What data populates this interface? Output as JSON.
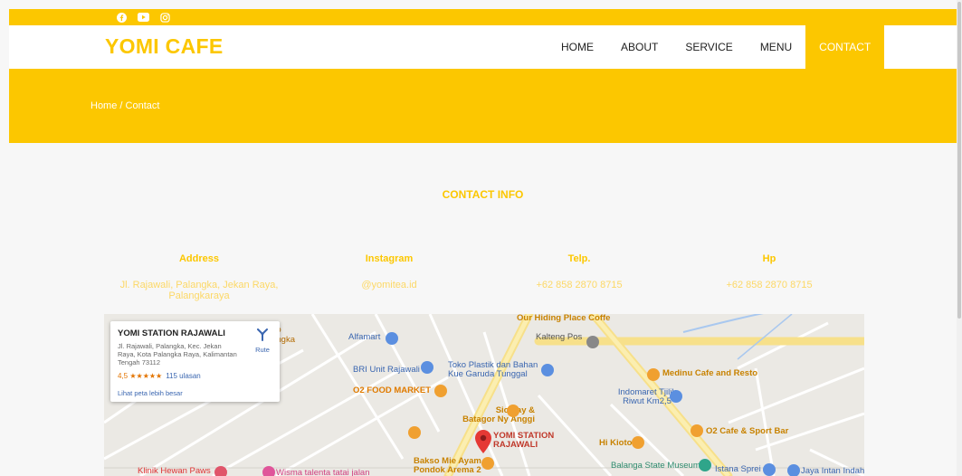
{
  "social": {
    "icons": [
      "facebook-icon",
      "youtube-icon",
      "instagram-icon"
    ]
  },
  "brand": {
    "name": "YOMI CAFE"
  },
  "nav": {
    "items": [
      {
        "label": "HOME",
        "active": false
      },
      {
        "label": "ABOUT",
        "active": false
      },
      {
        "label": "SERVICE",
        "active": false
      },
      {
        "label": "MENU",
        "active": false
      },
      {
        "label": "CONTACT",
        "active": true
      }
    ]
  },
  "breadcrumb": {
    "text": "Home / Contact"
  },
  "contact": {
    "title": "CONTACT INFO",
    "address": {
      "label": "Address",
      "value": "Jl. Rajawali, Palangka, Jekan Raya, Palangkaraya"
    },
    "instagram": {
      "label": "Instagram",
      "value": "@yomitea.id"
    },
    "telp": {
      "label": "Telp.",
      "value": "+62 858 2870 8715"
    },
    "hp": {
      "label": "Hp",
      "value": "+62 858 2870 8715"
    }
  },
  "map": {
    "card": {
      "title": "YOMI STATION RAJAWALI",
      "address": "Jl. Rajawali, Palangka, Kec. Jekan Raya, Kota Palangka Raya, Kalimantan Tengah 73112",
      "rating": "4,5 ★★★★★",
      "reviews": "115 ulasan",
      "larger_map": "Lihat peta lebih besar",
      "route": "Rute"
    },
    "places": {
      "hiding": "Our Hiding Place Coffe",
      "kalteng": "Kalteng Pos",
      "alfamart": "Alfamart",
      "bri": "BRI Unit Rajawali",
      "toko": "Toko Plastik dan Bahan Kue Garuda Tunggal",
      "medinu": "Medinu Cafe and Resto",
      "o2food": "O2 FOOD MARKET",
      "indomaret": "Indomaret Tjilik Riwut Km2,5",
      "siomay": "Siomay & Batagor Ny Anggi",
      "o2cafe": "O2 Cafe & Sport Bar",
      "yomi": "YOMI STATION RAJAWALI",
      "hikioto": "Hi Kioto",
      "bakso": "Bakso Mie Ayam Pondok Arema 2",
      "balanga": "Balanga State Museum",
      "istana": "Istana Sprei",
      "klinik": "Klinik Hewan Paws",
      "wisma": "Wisma talenta tatai jalan",
      "jaya": "Jaya Intan Indah"
    }
  },
  "colors": {
    "accent": "#fcc700",
    "accent_light": "#fcd866"
  }
}
